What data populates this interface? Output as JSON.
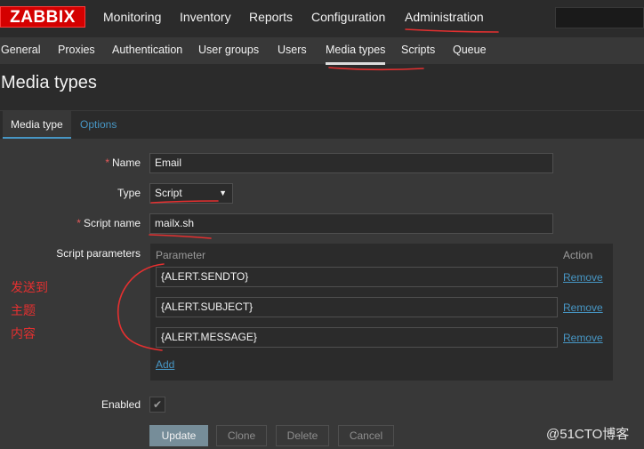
{
  "logo": "ZABBIX",
  "top_menu": [
    "Monitoring",
    "Inventory",
    "Reports",
    "Configuration",
    "Administration"
  ],
  "sub_menu": [
    "General",
    "Proxies",
    "Authentication",
    "User groups",
    "Users",
    "Media types",
    "Scripts",
    "Queue"
  ],
  "page_title": "Media types",
  "tabs": {
    "media_type": "Media type",
    "options": "Options"
  },
  "form": {
    "name_label": "Name",
    "name_value": "Email",
    "type_label": "Type",
    "type_value": "Script",
    "script_name_label": "Script name",
    "script_name_value": "mailx.sh",
    "script_params_label": "Script parameters",
    "params_header": "Parameter",
    "action_header": "Action",
    "params": [
      "{ALERT.SENDTO}",
      "{ALERT.SUBJECT}",
      "{ALERT.MESSAGE}"
    ],
    "remove_label": "Remove",
    "add_label": "Add",
    "enabled_label": "Enabled",
    "required_mark": "*"
  },
  "buttons": {
    "update": "Update",
    "clone": "Clone",
    "delete": "Delete",
    "cancel": "Cancel"
  },
  "annotation": [
    "发送到",
    "主题",
    "内容"
  ],
  "watermark": "@51CTO博客",
  "colors": {
    "logo": "#d40000",
    "link": "#4796c4",
    "annotation": "#e53030"
  }
}
